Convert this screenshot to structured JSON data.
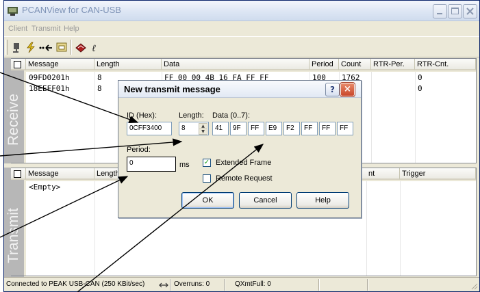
{
  "window": {
    "title": "PCANView for CAN-USB",
    "menu": [
      "Client",
      "Transmit",
      "Help"
    ]
  },
  "receive": {
    "side_label": "Receive",
    "columns": [
      "Message",
      "Length",
      "Data",
      "Period",
      "Count",
      "RTR-Per.",
      "RTR-Cnt."
    ],
    "rows": [
      {
        "message": "09FD0201h",
        "length": "8",
        "data": "FF 00 00 4B 16 FA FF FF",
        "period": "100",
        "count": "1762",
        "rtr_per": "",
        "rtr_cnt": "0"
      },
      {
        "message": "18EEFF01h",
        "length": "8",
        "data": "",
        "period": "",
        "count": "",
        "rtr_per": "",
        "rtr_cnt": "0"
      }
    ]
  },
  "transmit": {
    "side_label": "Transmit",
    "columns": [
      "Message",
      "Length",
      "Count",
      "Trigger"
    ],
    "count_header_visible": "nt",
    "empty_text": "<Empty>"
  },
  "dialog": {
    "title": "New transmit message",
    "help_glyph": "?",
    "close_glyph": "×",
    "id_label": "ID (Hex):",
    "id_value": "0CFF3400",
    "length_label": "Length:",
    "length_value": "8",
    "data_label": "Data (0..7):",
    "data_bytes": [
      "41",
      "9F",
      "FF",
      "E9",
      "F2",
      "FF",
      "FF",
      "FF"
    ],
    "period_label": "Period:",
    "period_value": "0",
    "period_unit": "ms",
    "extended_label": "Extended Frame",
    "extended_checked": true,
    "remote_label": "Remote Request",
    "remote_checked": false,
    "ok_label": "OK",
    "cancel_label": "Cancel",
    "help_label": "Help"
  },
  "status": {
    "connection": "Connected to PEAK USB-CAN (250 KBit/sec)",
    "overruns": "Overruns: 0",
    "qxmtfull": "QXmtFull: 0"
  },
  "colors": {
    "dialog_bg": "#ece9d8",
    "sidebar_bg": "#b7b7b7",
    "border_blue": "#7f9db9"
  }
}
